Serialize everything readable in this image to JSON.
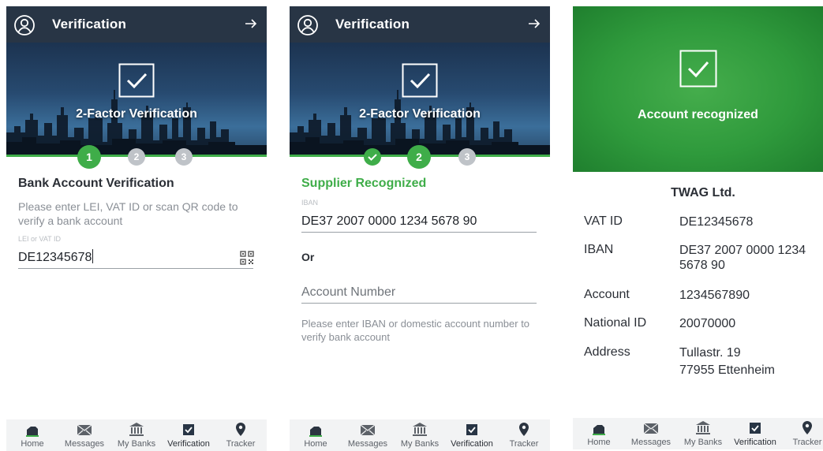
{
  "header": {
    "title": "Verification"
  },
  "hero": {
    "title": "2-Factor Verification"
  },
  "nav": [
    {
      "label": "Home",
      "icon": "home-icon"
    },
    {
      "label": "Messages",
      "icon": "envelope-icon"
    },
    {
      "label": "My Banks",
      "icon": "bank-icon"
    },
    {
      "label": "Verification",
      "icon": "checkbox-icon"
    },
    {
      "label": "Tracker",
      "icon": "map-pin-icon"
    }
  ],
  "screen1": {
    "steps": [
      "1",
      "2",
      "3"
    ],
    "heading": "Bank Account Verification",
    "description": "Please enter LEI, VAT ID or scan QR code to verify a bank account",
    "field_label": "LEI or VAT ID",
    "field_value": "DE12345678"
  },
  "screen2": {
    "steps": [
      "2",
      "3"
    ],
    "heading": "Supplier Recognized",
    "iban_label": "IBAN",
    "iban_value": "DE37 2007 0000 1234 5678 90",
    "or_label": "Or",
    "account_placeholder": "Account Number",
    "help_text": "Please enter IBAN or domestic account number to verify bank account"
  },
  "screen3": {
    "banner_title": "Account recognized",
    "company": "TWAG Ltd.",
    "rows": [
      {
        "label": "VAT ID",
        "value": "DE12345678"
      },
      {
        "label": "IBAN",
        "value": "DE37 2007 0000 1234 5678 90"
      },
      {
        "label": "Account",
        "value": "1234567890"
      },
      {
        "label": "National ID",
        "value": "20070000"
      },
      {
        "label": "Address",
        "value": "Tullastr. 19",
        "value2": "77955 Ettenheim"
      }
    ]
  },
  "colors": {
    "header": "#283545",
    "accent": "#3fad49",
    "inactive_step": "#bfc3c8",
    "nav_bg": "#f2f3f4"
  }
}
